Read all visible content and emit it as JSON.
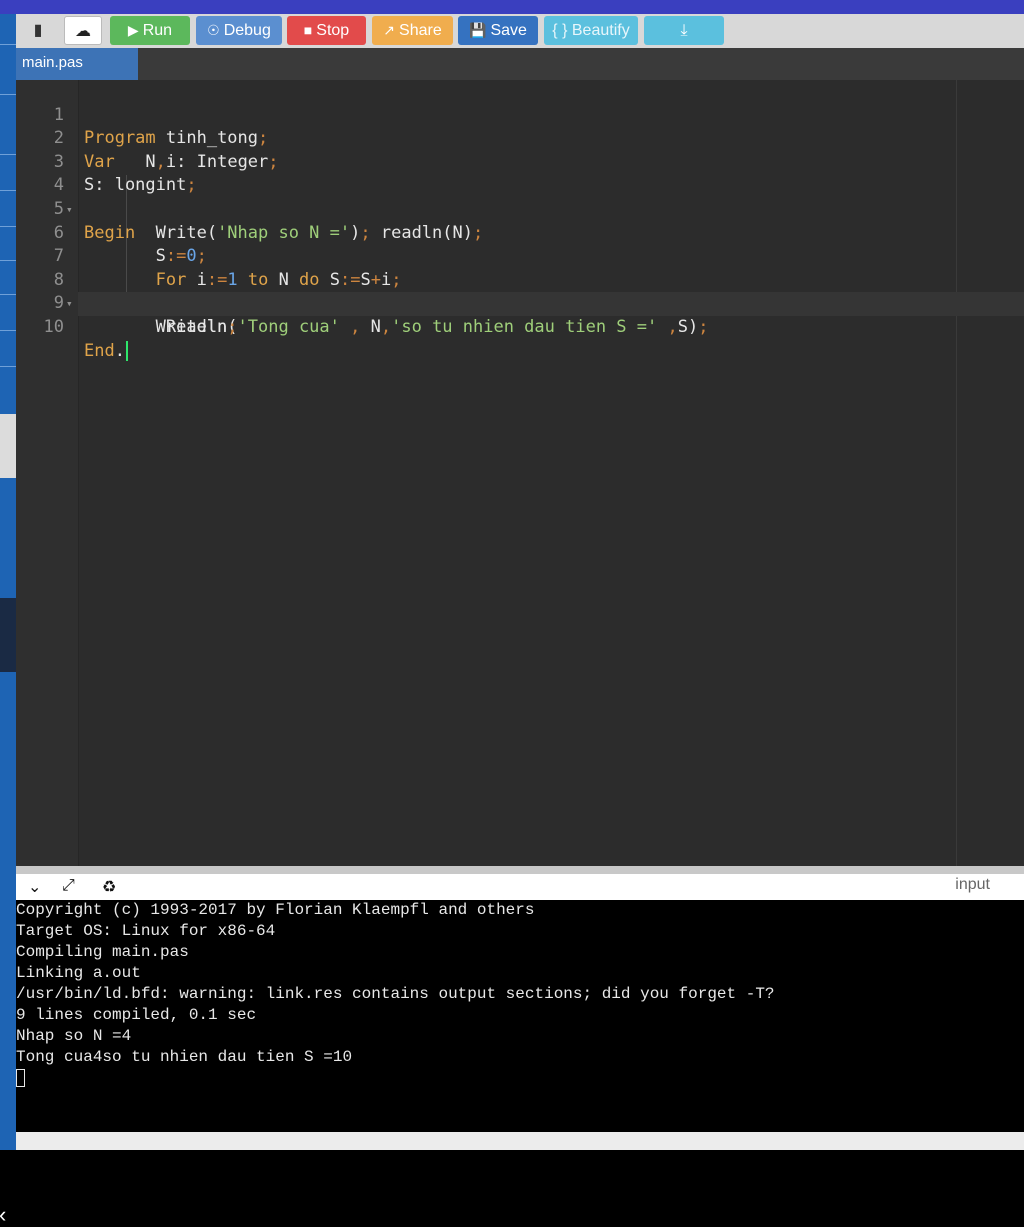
{
  "toolbar": {
    "buttons": [
      {
        "label": "",
        "icon": "new-file-icon",
        "color": "#d8d8d8"
      },
      {
        "label": "",
        "icon": "upload-icon",
        "color": "#ffffff"
      },
      {
        "label": "Run",
        "icon": "play-icon",
        "color": "#5cb85c"
      },
      {
        "label": "Debug",
        "icon": "debug-icon",
        "color": "#5b8fd0"
      },
      {
        "label": "Stop",
        "icon": "stop-icon",
        "color": "#e24b4b"
      },
      {
        "label": "Share",
        "icon": "share-icon",
        "color": "#f0ad4e"
      },
      {
        "label": "Save",
        "icon": "save-icon",
        "color": "#3572c0"
      },
      {
        "label": "{ } Beautify",
        "icon": "",
        "color": "#5bc0de"
      },
      {
        "label": "",
        "icon": "download-icon",
        "color": "#5bc0de"
      }
    ]
  },
  "tab": {
    "label": "main.pas"
  },
  "editor": {
    "line_numbers": [
      "1",
      "2",
      "3",
      "4",
      "5",
      "6",
      "7",
      "8",
      "9",
      "10"
    ],
    "fold_markers": [
      "4",
      "8"
    ]
  },
  "output": {
    "input_label": "input",
    "lines": [
      "Copyright (c) 1993-2017 by Florian Klaempfl and others",
      "Target OS: Linux for x86-64",
      "Compiling main.pas",
      "Linking a.out",
      "/usr/bin/ld.bfd: warning: link.res contains output sections; did you forget -T?",
      "9 lines compiled, 0.1 sec",
      "Nhap so N =4",
      "Tong cua4so tu nhien dau tien S =10"
    ]
  },
  "colors": {
    "keyword": "#e0a44a",
    "string": "#9fcf7a",
    "number": "#6aa6e8",
    "editor_bg": "#2c2c2c",
    "tab_bg": "#3d73b6"
  }
}
